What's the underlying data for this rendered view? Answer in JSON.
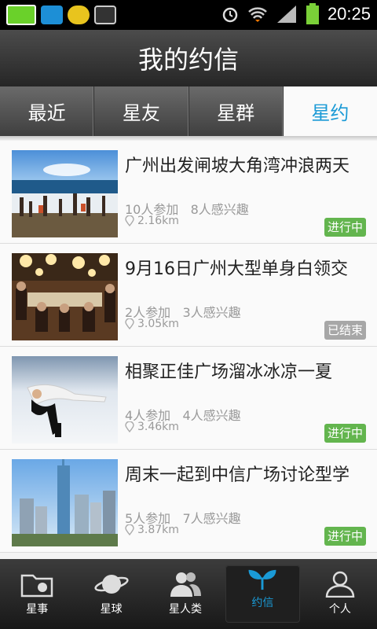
{
  "status_bar": {
    "time": "20:25",
    "left_icons": [
      "sim-6-icon",
      "qq-icon",
      "chat-mail-icon",
      "image-icon"
    ],
    "right_icons": [
      "alarm-icon",
      "wifi-icon",
      "signal-icon",
      "battery-icon"
    ]
  },
  "header": {
    "title": "我的约信"
  },
  "tabs": [
    {
      "label": "最近",
      "active": false
    },
    {
      "label": "星友",
      "active": false
    },
    {
      "label": "星群",
      "active": false
    },
    {
      "label": "星约",
      "active": true
    }
  ],
  "events": [
    {
      "title": "广州出发闸坡大角湾冲浪两天",
      "stats": "10人参加   8人感兴趣",
      "distance": "2.16km",
      "status": "进行中",
      "image": "beach-photo"
    },
    {
      "title": "9月16日广州大型单身白领交",
      "stats": "2人参加   3人感兴趣",
      "distance": "3.05km",
      "status": "已结束",
      "image": "restaurant-photo"
    },
    {
      "title": "相聚正佳广场溜冰冰凉一夏",
      "stats": "4人参加   4人感兴趣",
      "distance": "3.46km",
      "status": "进行中",
      "image": "ice-skating-photo"
    },
    {
      "title": "周末一起到中信广场讨论型学",
      "stats": "5人参加   7人感兴趣",
      "distance": "3.87km",
      "status": "进行中",
      "image": "skyline-photo"
    }
  ],
  "bottom_nav": [
    {
      "label": "星事",
      "icon": "folder-icon"
    },
    {
      "label": "星球",
      "icon": "planet-icon"
    },
    {
      "label": "星人类",
      "icon": "people-icon"
    },
    {
      "label": "约信",
      "icon": "sprout-icon",
      "active": true
    },
    {
      "label": "个人",
      "icon": "person-icon"
    }
  ],
  "colors": {
    "accent": "#1a9ad6",
    "status_active": "#63b54e",
    "status_ended": "#a7a7a7"
  }
}
